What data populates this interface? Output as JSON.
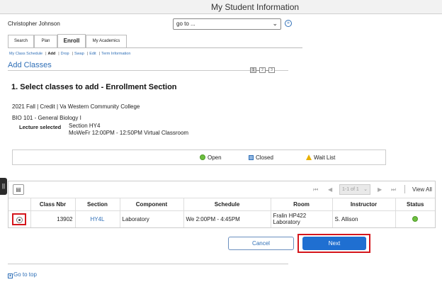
{
  "header": {
    "title": "My Student Information"
  },
  "user": {
    "name": "Christopher Johnson"
  },
  "goto": {
    "value": "go to ..."
  },
  "tabs": [
    {
      "label": "Search"
    },
    {
      "label": "Plan"
    },
    {
      "label": "Enroll"
    },
    {
      "label": "My Academics"
    }
  ],
  "subnav": [
    {
      "label": "My Class Schedule"
    },
    {
      "label": "Add"
    },
    {
      "label": "Drop"
    },
    {
      "label": "Swap"
    },
    {
      "label": "Edit"
    },
    {
      "label": "Term Information"
    }
  ],
  "page": {
    "title": "Add Classes"
  },
  "steps": [
    "1",
    "2",
    "3"
  ],
  "section_heading": "1.  Select classes to add - Enrollment Section",
  "term": "2021 Fall | Credit | Va Western Community College",
  "course": "BIO  101 - General Biology I",
  "lecture": {
    "label": "Lecture selected",
    "section": "Section HY4",
    "schedule": "MoWeFr 12:00PM - 12:50PM   Virtual Classroom"
  },
  "legend": {
    "open": "Open",
    "closed": "Closed",
    "waitlist": "Wait List"
  },
  "colors": {
    "open": "#6dbf3f",
    "closed": "#8fb5e0",
    "waitlist": "#e8b000",
    "accent": "#2f6fb7",
    "primary_button": "#1f6fd1",
    "highlight": "#d4161c"
  },
  "grid": {
    "pager": "1-1 of 1",
    "view_all": "View All",
    "columns": [
      "",
      "Class Nbr",
      "Section",
      "Component",
      "Schedule",
      "Room",
      "Instructor",
      "Status"
    ],
    "rows": [
      {
        "class_nbr": "13902",
        "section": "HY4L",
        "component": "Laboratory",
        "schedule": "We 2:00PM - 4:45PM",
        "room_line1": "Fralin HP422",
        "room_line2": "Laboratory",
        "instructor": "S. Allison",
        "status": "Open"
      }
    ]
  },
  "buttons": {
    "cancel": "Cancel",
    "next": "Next"
  },
  "footer": {
    "go_to_top": "Go to top"
  }
}
